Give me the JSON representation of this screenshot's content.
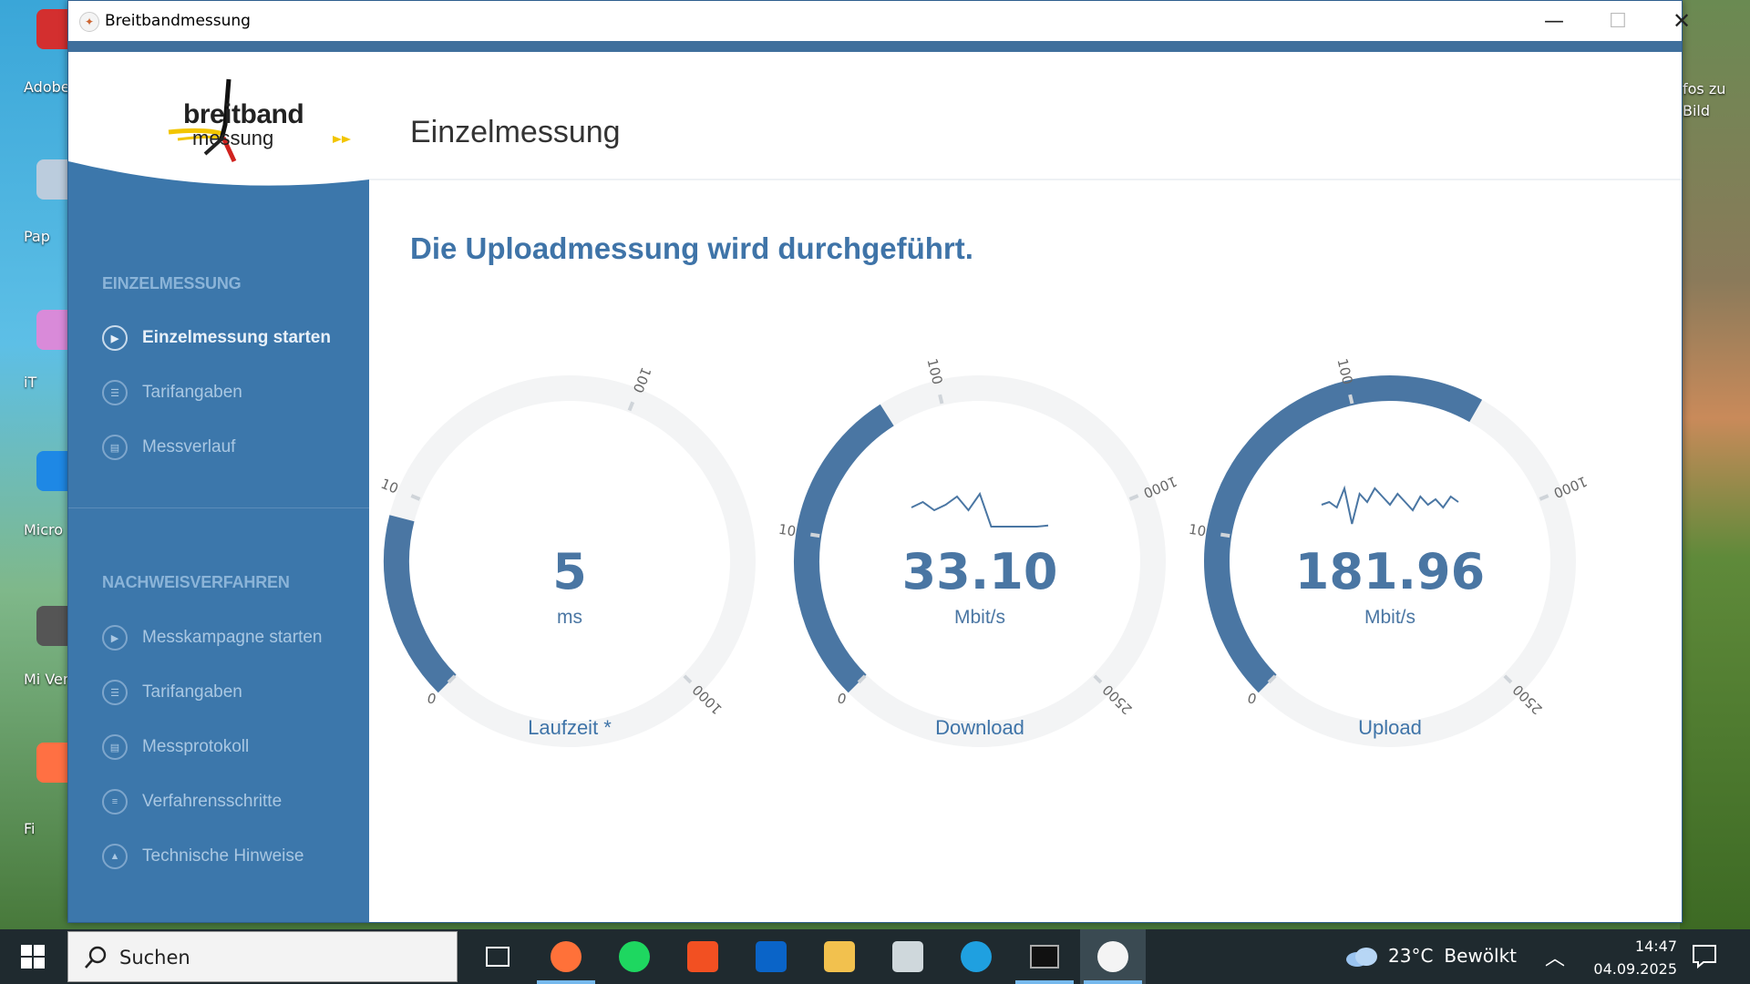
{
  "desktop": {
    "icons": [
      {
        "label": "Adobe",
        "color": "#d32f2f"
      },
      {
        "label": "Pap",
        "color": "#bcd"
      },
      {
        "label": "iT",
        "color": "#d98ad9"
      },
      {
        "label": "Micro",
        "color": "#1e88e5"
      },
      {
        "label": "Mi Verk",
        "color": "#555"
      },
      {
        "label": "Fi",
        "color": "#ff7043"
      }
    ],
    "right_label": "fos zu Bild"
  },
  "window": {
    "title": "Breitbandmessung",
    "controls": {
      "minimize": "—",
      "maximize": "☐",
      "close": "✕"
    }
  },
  "logo": {
    "line1": "breitband",
    "line2": "messung"
  },
  "sidebar": {
    "section1": {
      "heading": "EINZELMESSUNG",
      "items": [
        {
          "label": "Einzelmessung starten",
          "icon": "play-icon",
          "active": true
        },
        {
          "label": "Tarifangaben",
          "icon": "user-card-icon"
        },
        {
          "label": "Messverlauf",
          "icon": "clipboard-icon"
        }
      ]
    },
    "section2": {
      "heading": "NACHWEISVERFAHREN",
      "items": [
        {
          "label": "Messkampagne starten",
          "icon": "play-icon"
        },
        {
          "label": "Tarifangaben",
          "icon": "user-card-icon"
        },
        {
          "label": "Messprotokoll",
          "icon": "clipboard-icon"
        },
        {
          "label": "Verfahrensschritte",
          "icon": "list-icon"
        },
        {
          "label": "Technische Hinweise",
          "icon": "warning-icon"
        }
      ]
    }
  },
  "main": {
    "title": "Einzelmessung",
    "status": "Die Uploadmessung wird durchgeführt."
  },
  "gauges": [
    {
      "id": "latency",
      "value": "5",
      "unit": "ms",
      "label": "Laufzeit *",
      "ticks": [
        "0",
        "10",
        "100",
        "1000"
      ],
      "fill_fraction": 0.22,
      "sparkline": null
    },
    {
      "id": "download",
      "value": "33.10",
      "unit": "Mbit/s",
      "label": "Download",
      "ticks": [
        "0",
        "10",
        "100",
        "1000",
        "2500"
      ],
      "fill_fraction": 0.38,
      "sparkline": [
        0.55,
        0.45,
        0.6,
        0.5,
        0.35,
        0.6,
        0.3,
        0.9,
        0.9,
        0.9,
        0.9,
        0.9,
        0.88
      ]
    },
    {
      "id": "upload",
      "value": "181.96",
      "unit": "Mbit/s",
      "label": "Upload",
      "ticks": [
        "0",
        "10",
        "100",
        "1000",
        "2500"
      ],
      "fill_fraction": 0.61,
      "sparkline": [
        0.5,
        0.45,
        0.55,
        0.2,
        0.85,
        0.3,
        0.45,
        0.2,
        0.35,
        0.5,
        0.3,
        0.45,
        0.6,
        0.35,
        0.5,
        0.4,
        0.55,
        0.35,
        0.45
      ]
    }
  ],
  "taskbar": {
    "search_placeholder": "Suchen",
    "apps": [
      {
        "name": "task-view",
        "running": false
      },
      {
        "name": "firefox",
        "running": true
      },
      {
        "name": "spotify",
        "running": false
      },
      {
        "name": "store",
        "running": false
      },
      {
        "name": "outlook",
        "running": false
      },
      {
        "name": "explorer",
        "running": false
      },
      {
        "name": "notepad",
        "running": false
      },
      {
        "name": "edge",
        "running": false
      },
      {
        "name": "terminal",
        "running": true
      },
      {
        "name": "breitbandmessung",
        "running": true,
        "active": true
      }
    ],
    "weather": {
      "temp": "23°C",
      "text": "Bewölkt"
    },
    "time": "14:47",
    "date": "04.09.2025"
  },
  "colors": {
    "accent": "#3f6f9c",
    "sidebar": "#3c77ab",
    "gauge_fill": "#4a76a3",
    "gauge_track": "#f3f4f5",
    "status": "#3f74a8"
  }
}
